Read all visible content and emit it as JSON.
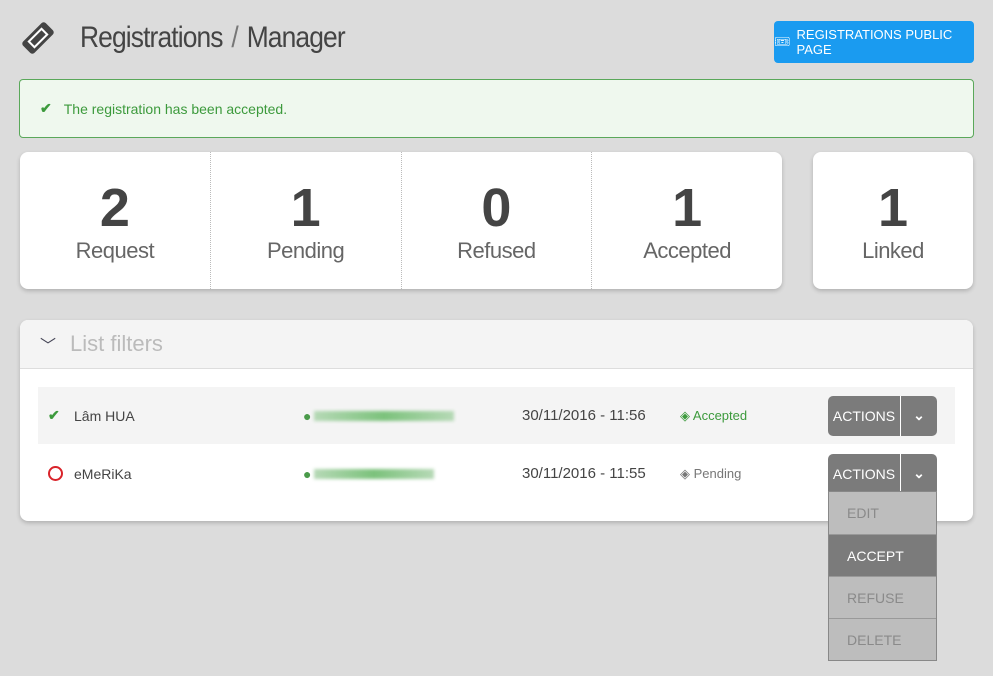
{
  "header": {
    "title": "Registrations",
    "separator": "/",
    "subtitle": "Manager",
    "public_button": "REGISTRATIONS PUBLIC PAGE"
  },
  "alert": {
    "message": "The registration has been accepted.",
    "color": "#3c9a3c"
  },
  "stats": [
    {
      "value": "2",
      "label": "Request"
    },
    {
      "value": "1",
      "label": "Pending"
    },
    {
      "value": "0",
      "label": "Refused"
    },
    {
      "value": "1",
      "label": "Accepted"
    }
  ],
  "linked": {
    "value": "1",
    "label": "Linked"
  },
  "filters": {
    "label": "List filters"
  },
  "rows": [
    {
      "name": "Lâm HUA",
      "date": "30/11/2016 - 11:56",
      "status": "Accepted",
      "status_icon": "check-icon",
      "actions": "ACTIONS"
    },
    {
      "name": "eMeRiKa",
      "date": "30/11/2016 - 11:55",
      "status": "Pending",
      "status_icon": "circle-icon",
      "actions": "ACTIONS"
    }
  ],
  "menu": [
    {
      "label": "EDIT"
    },
    {
      "label": "ACCEPT",
      "active": true
    },
    {
      "label": "REFUSE"
    },
    {
      "label": "DELETE"
    }
  ],
  "colors": {
    "accent": "#1a9bf0",
    "success": "#3c9a3c",
    "pending": "#d9232a"
  }
}
